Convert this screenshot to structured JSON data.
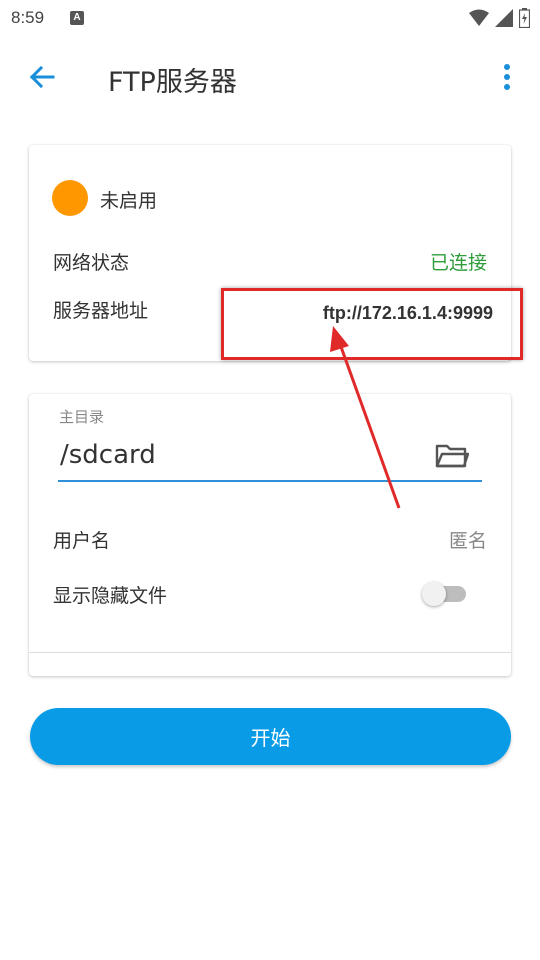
{
  "status_bar": {
    "time": "8:59",
    "notification_letter": "A"
  },
  "app_bar": {
    "title": "FTP服务器",
    "back_icon": "arrow-back-icon",
    "more_icon": "more-vert-icon"
  },
  "status_card": {
    "state": "未启用",
    "state_color": "#ff9800",
    "network_label": "网络状态",
    "network_value": "已连接",
    "network_value_color": "#2e9d3a",
    "address_label": "服务器地址",
    "address_value": "ftp://172.16.1.4:9999"
  },
  "settings_card": {
    "home_dir_label": "主目录",
    "home_dir_value": "/sdcard",
    "folder_icon": "folder-open-icon",
    "username_label": "用户名",
    "username_value": "匿名",
    "show_hidden_label": "显示隐藏文件",
    "show_hidden_enabled": false
  },
  "start_button": {
    "label": "开始",
    "color": "#0a9be7"
  },
  "accent_color": "#2f8fd8",
  "annotation_color": "#e02a2a"
}
